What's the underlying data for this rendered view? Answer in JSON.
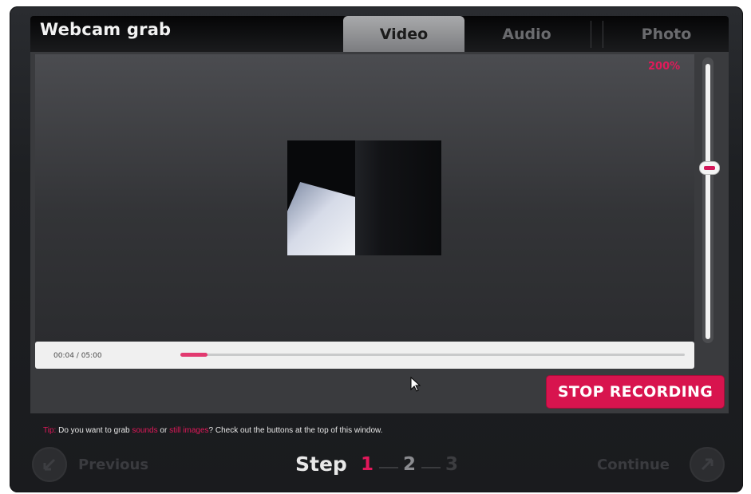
{
  "app": {
    "title": "Webcam grab"
  },
  "tabs": [
    {
      "label": "Video",
      "active": true
    },
    {
      "label": "Audio",
      "active": false
    },
    {
      "label": "Photo",
      "active": false
    }
  ],
  "viewer": {
    "zoom_readout": "200%",
    "zoom_level_fraction": 0.36
  },
  "timeline": {
    "time_display": "00:04 / 05:00",
    "progress_fraction": 0.013
  },
  "actions": {
    "stop_label": "STOP RECORDING"
  },
  "tip": {
    "prefix": "Tip:",
    "text_1": " Do you want to grab ",
    "link_1": "sounds",
    "text_2": " or ",
    "link_2": "still images",
    "text_3": "? Check out the buttons at the top of this window."
  },
  "navigation": {
    "previous_label": "Previous",
    "continue_label": "Continue",
    "step_label": "Step",
    "steps": [
      "1",
      "2",
      "3"
    ],
    "current_step": 1
  },
  "colors": {
    "accent": "#d8144e",
    "background": "#1d1f22",
    "panel": "#3a3b3e"
  },
  "icons": {
    "previous": "arrow-left-icon",
    "continue": "arrow-right-icon",
    "cursor": "mouse-pointer-icon"
  }
}
